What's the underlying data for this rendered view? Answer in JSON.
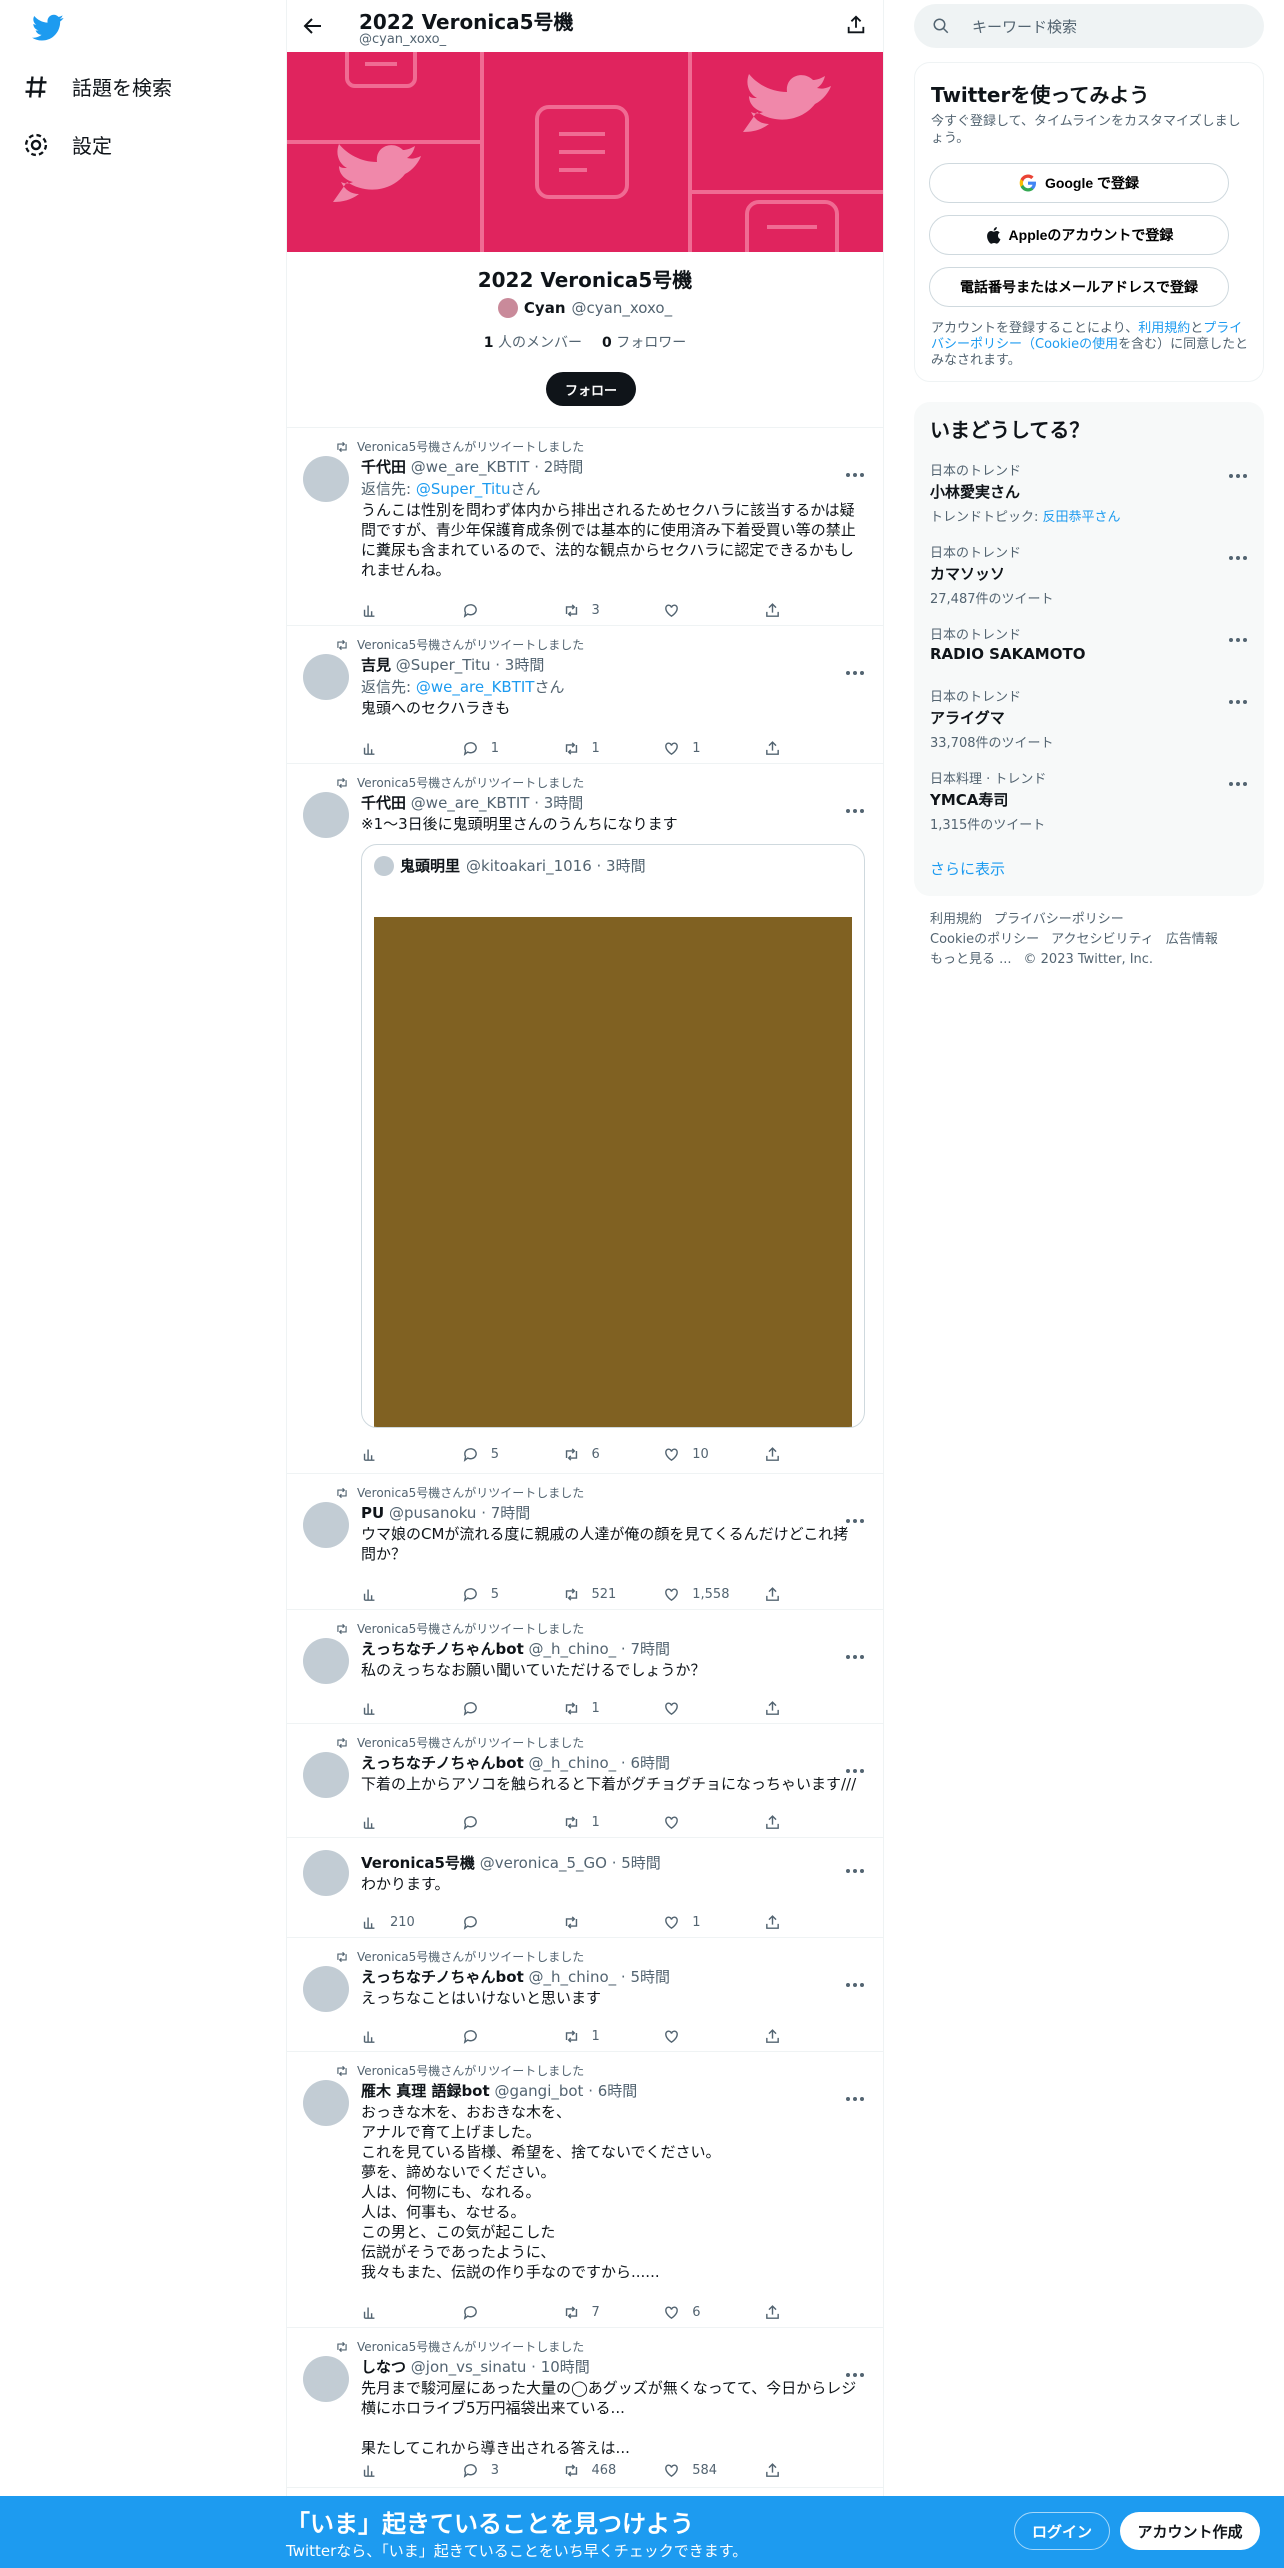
{
  "nav": {
    "explore": "話題を検索",
    "settings": "設定"
  },
  "header": {
    "title": "2022 Veronica5号機",
    "handle": "@cyan_xoxo_"
  },
  "list": {
    "name": "2022 Veronica5号機",
    "owner_name": "Cyan",
    "owner_handle": "@cyan_xoxo_",
    "members_count": "1",
    "members_label": "人のメンバー",
    "followers_count": "0",
    "followers_label": "フォロワー",
    "follow_button": "フォロー"
  },
  "tweets": [
    {
      "retweet_label": "Veronica5号機さんがリツイートしました",
      "name": "千代田",
      "meta": "@we_are_KBTIT · 2時間",
      "reply_prefix": "返信先: ",
      "reply_to": "@Super_Titu",
      "reply_suffix": "さん",
      "text": "うんこは性別を問わず体内から排出されるためセクハラに該当するかは疑問ですが、青少年保護育成条例では基本的に使用済み下着受買い等の禁止に糞尿も含まれているので、法的な観点からセクハラに認定できるかもしれませんね。",
      "views": "",
      "replies": "",
      "retweets": "3",
      "likes": ""
    },
    {
      "retweet_label": "Veronica5号機さんがリツイートしました",
      "name": "吉見",
      "meta": "@Super_Titu · 3時間",
      "reply_prefix": "返信先: ",
      "reply_to": "@we_are_KBTIT",
      "reply_suffix": "さん",
      "text": "鬼頭へのセクハラきも",
      "views": "",
      "replies": "1",
      "retweets": "1",
      "likes": "1"
    },
    {
      "retweet_label": "Veronica5号機さんがリツイートしました",
      "name": "千代田",
      "meta": "@we_are_KBTIT · 3時間",
      "text": "※1〜3日後に鬼頭明里さんのうんちになります",
      "quote": {
        "name": "鬼頭明里",
        "meta": "@kitoakari_1016 · 3時間",
        "image_color": "#806122"
      },
      "views": "",
      "replies": "5",
      "retweets": "6",
      "likes": "10"
    },
    {
      "retweet_label": "Veronica5号機さんがリツイートしました",
      "name": "PU",
      "meta": "@pusanoku · 7時間",
      "text": "ウマ娘のCMが流れる度に親戚の人達が俺の顔を見てくるんだけどこれ拷問か？",
      "views": "",
      "replies": "5",
      "retweets": "521",
      "likes": "1,558"
    },
    {
      "retweet_label": "Veronica5号機さんがリツイートしました",
      "name": "えっちなチノちゃんbot",
      "meta": "@_h_chino_ · 7時間",
      "text": "私のえっちなお願い聞いていただけるでしょうか？",
      "views": "",
      "replies": "",
      "retweets": "1",
      "likes": ""
    },
    {
      "retweet_label": "Veronica5号機さんがリツイートしました",
      "name": "えっちなチノちゃんbot",
      "meta": "@_h_chino_ · 6時間",
      "text": "下着の上からアソコを触られると下着がグチョグチョになっちゃいます///",
      "views": "",
      "replies": "",
      "retweets": "1",
      "likes": ""
    },
    {
      "retweet_label": "",
      "name": "Veronica5号機",
      "meta": "@veronica_5_GO · 5時間",
      "text": "わかります。",
      "views": "210",
      "replies": "",
      "retweets": "",
      "likes": "1"
    },
    {
      "retweet_label": "Veronica5号機さんがリツイートしました",
      "name": "えっちなチノちゃんbot",
      "meta": "@_h_chino_ · 5時間",
      "text": "えっちなことはいけないと思います",
      "views": "",
      "replies": "",
      "retweets": "1",
      "likes": ""
    },
    {
      "retweet_label": "Veronica5号機さんがリツイートしました",
      "name": "雁木 真理 語録bot",
      "meta": "@gangi_bot · 6時間",
      "text": "おっきな木を、おおきな木を、\nアナルで育て上げました。\nこれを見ている皆様、希望を、捨てないでください。\n夢を、諦めないでください。\n人は、何物にも、なれる。\n人は、何事も、なせる。\nこの男と、この気が起こした\n伝説がそうであったように、\n我々もまた、伝説の作り手なのですから......",
      "views": "",
      "replies": "",
      "retweets": "7",
      "likes": "6"
    },
    {
      "retweet_label": "Veronica5号機さんがリツイートしました",
      "name": "しなつ",
      "meta": "@jon_vs_sinatu · 10時間",
      "text": "先月まで駿河屋にあった大量の◯あグッズが無くなってて、今日からレジ横にホロライブ5万円福袋出来ている...\n\n果たしてこれから導き出される答えは...",
      "views": "",
      "replies": "3",
      "retweets": "468",
      "likes": "584"
    }
  ],
  "search": {
    "placeholder": "キーワード検索"
  },
  "signup": {
    "title": "Twitterを使ってみよう",
    "desc": "今すぐ登録して、タイムラインをカスタマイズしましょう。",
    "google": "Google で登録",
    "apple": "Appleのアカウントで登録",
    "phone": "電話番号またはメールアドレスで登録",
    "terms_1": "アカウントを登録することにより、",
    "terms_link1": "利用規約",
    "terms_2": "と",
    "terms_link2": "プライバシーポリシー（Cookieの使用",
    "terms_3": "を含む）に同意したとみなされます。"
  },
  "trends": {
    "title": "いまどうしてる？",
    "items": [
      {
        "context": "日本のトレンド",
        "name": "小林愛実さん",
        "extra_prefix": "トレンドトピック: ",
        "extra_link": "反田恭平さん"
      },
      {
        "context": "日本のトレンド",
        "name": "カマソッソ",
        "extra": "27,487件のツイート"
      },
      {
        "context": "日本のトレンド",
        "name": "RADIO SAKAMOTO",
        "extra": ""
      },
      {
        "context": "日本のトレンド",
        "name": "アライグマ",
        "extra": "33,708件のツイート"
      },
      {
        "context": "日本料理 · トレンド",
        "name": "YMCA寿司",
        "extra": "1,315件のツイート"
      }
    ],
    "show_more": "さらに表示"
  },
  "footer": {
    "l1": "利用規約",
    "l2": "プライバシーポリシー",
    "l3": "Cookieのポリシー",
    "l4": "アクセシビリティ",
    "l5": "広告情報",
    "l6": "もっと見る ...",
    "l7": "© 2023 Twitter, Inc."
  },
  "bottom": {
    "title": "「いま」起きていることを見つけよう",
    "sub": "Twitterなら、「いま」起きていることをいち早くチェックできます。",
    "login": "ログイン",
    "signup": "アカウント作成"
  },
  "colors": {
    "brand": "#1d9bf0",
    "banner": "#e0245e",
    "text": "#0f1419",
    "muted": "#536471"
  }
}
